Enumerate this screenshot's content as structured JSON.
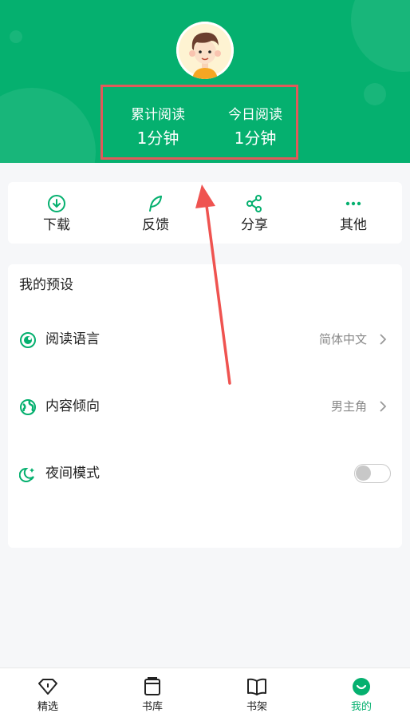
{
  "colors": {
    "brand": "#05b06f",
    "highlight_box": "#e05a5a"
  },
  "header": {
    "avatar_icon": "boy-avatar",
    "stats": [
      {
        "label": "累计阅读",
        "value": "1分钟"
      },
      {
        "label": "今日阅读",
        "value": "1分钟"
      }
    ]
  },
  "quick_actions": [
    {
      "label": "下载",
      "icon": "download-icon"
    },
    {
      "label": "反馈",
      "icon": "feather-icon"
    },
    {
      "label": "分享",
      "icon": "share-icon"
    },
    {
      "label": "其他",
      "icon": "more-icon"
    }
  ],
  "settings": {
    "title": "我的预设",
    "rows": [
      {
        "label": "阅读语言",
        "value": "简体中文",
        "icon": "language-icon"
      },
      {
        "label": "内容倾向",
        "value": "男主角",
        "icon": "globe-icon"
      },
      {
        "label": "夜间模式",
        "icon": "moon-icon",
        "toggle_on": false
      }
    ]
  },
  "tabbar": [
    {
      "label": "精选",
      "icon": "diamond-icon",
      "active": false
    },
    {
      "label": "书库",
      "icon": "library-icon",
      "active": false
    },
    {
      "label": "书架",
      "icon": "book-icon",
      "active": false
    },
    {
      "label": "我的",
      "icon": "smile-icon",
      "active": true
    }
  ]
}
